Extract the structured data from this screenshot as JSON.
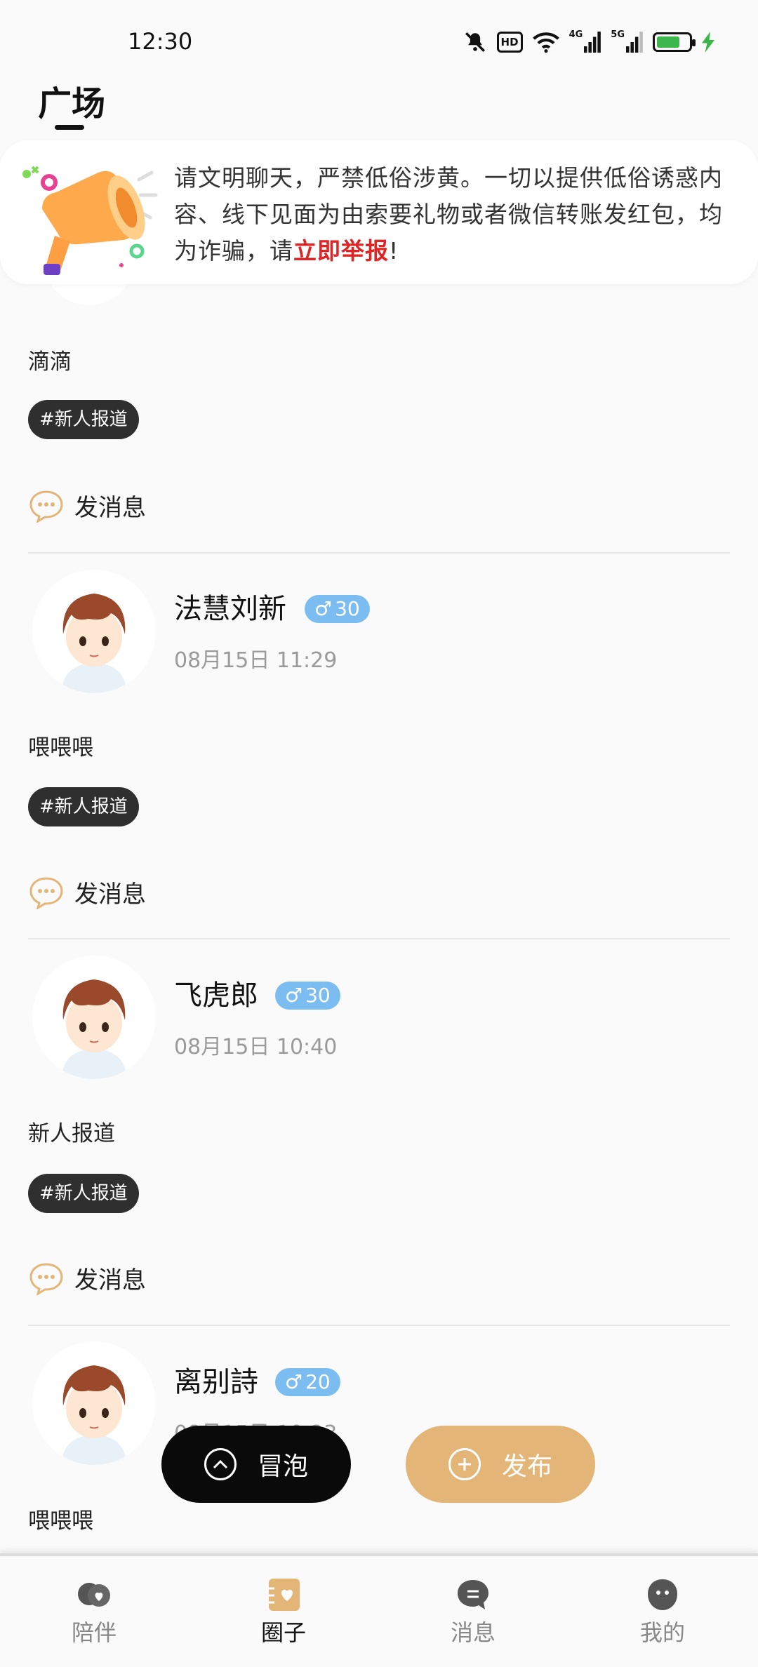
{
  "status_bar": {
    "time": "12:30",
    "icons": [
      "mute-icon",
      "hd-icon",
      "wifi-icon",
      "signal-4g-icon",
      "signal-5g-icon",
      "battery-icon",
      "charging-icon"
    ],
    "hd_label": "HD",
    "net_4g": "4G",
    "net_5g": "5G"
  },
  "header": {
    "title": "广场"
  },
  "notice": {
    "text_before": "请文明聊天，严禁低俗涉黄。一切以提供低俗诱惑内容、线下见面为由索要礼物或者微信转账发红包，均为诈骗，请",
    "link_text": "立即举报",
    "text_after": "!",
    "link_color": "#e02424"
  },
  "posts": [
    {
      "content": "滴滴",
      "tag": "#新人报道",
      "message_label": "发消息"
    },
    {
      "user_name": "法慧刘新",
      "gender_symbol": "♂",
      "age": "30",
      "time": "08月15日 11:29",
      "content": "喂喂喂",
      "tag": "#新人报道",
      "message_label": "发消息"
    },
    {
      "user_name": "飞虎郎",
      "gender_symbol": "♂",
      "age": "30",
      "time": "08月15日 10:40",
      "content": "新人报道",
      "tag": "#新人报道",
      "message_label": "发消息"
    },
    {
      "user_name": "离别詩",
      "gender_symbol": "♂",
      "age": "20",
      "time": "08月15日 10:23",
      "content": "喂喂喂"
    }
  ],
  "fab": {
    "bubble_label": "冒泡",
    "publish_label": "发布"
  },
  "bottom_nav": {
    "items": [
      {
        "label": "陪伴",
        "icon": "heart-chat-icon"
      },
      {
        "label": "圈子",
        "icon": "circle-heart-icon"
      },
      {
        "label": "消息",
        "icon": "message-icon"
      },
      {
        "label": "我的",
        "icon": "profile-face-icon"
      }
    ],
    "active": "圈子"
  },
  "colors": {
    "accent": "#e3b577",
    "badge": "#7bbdf0",
    "tag_bg": "#2f2f2f"
  }
}
